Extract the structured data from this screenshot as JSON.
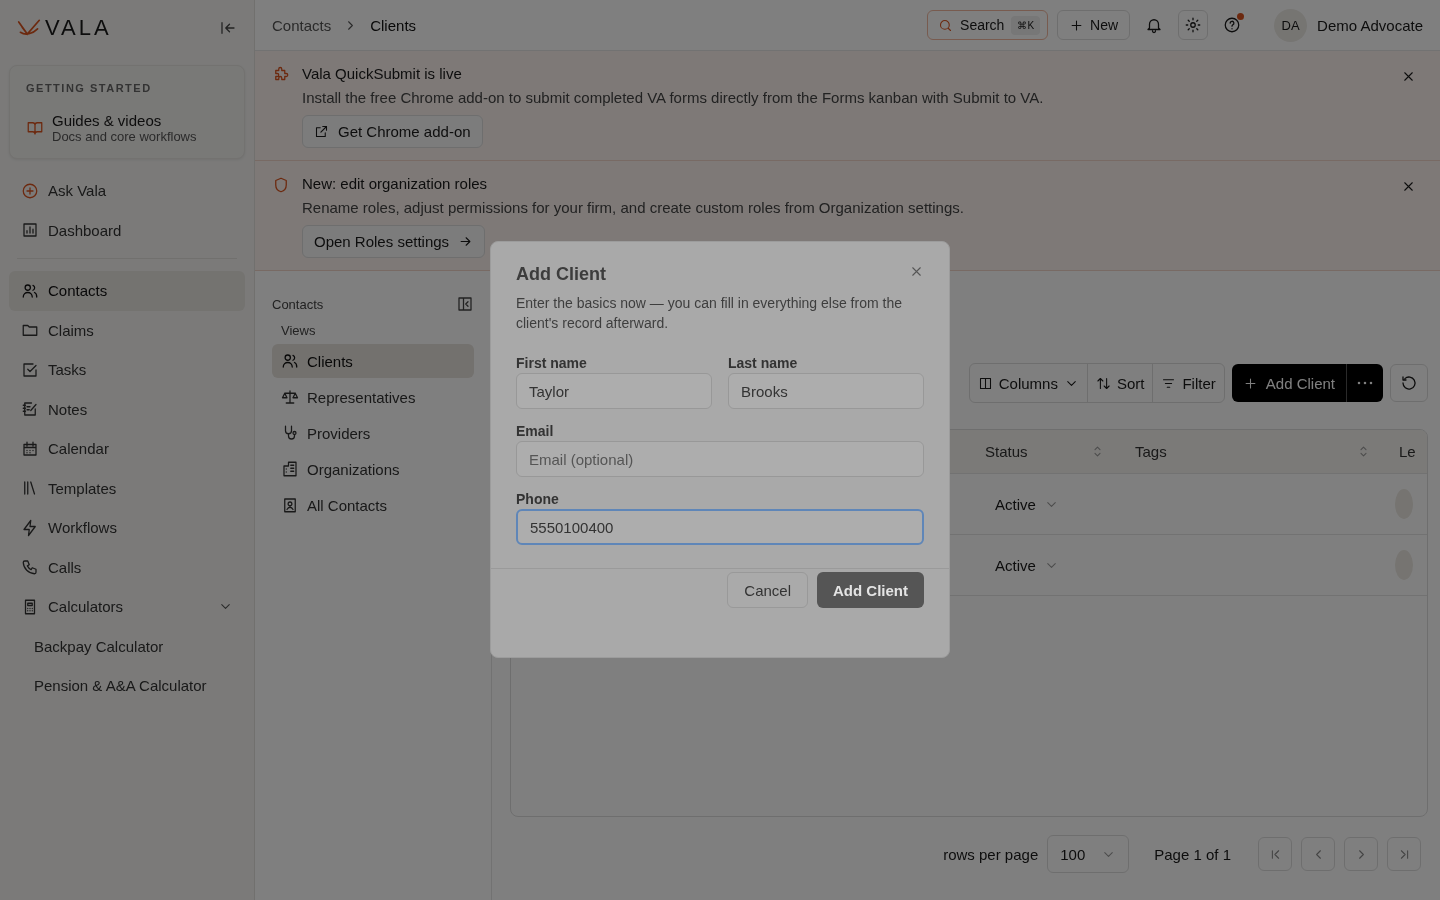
{
  "sidebar": {
    "logo": "VALA",
    "getting_started": {
      "heading": "GETTING STARTED",
      "title": "Guides & videos",
      "subtitle": "Docs and core workflows"
    },
    "top_items": [
      {
        "label": "Ask Vala",
        "selected": false
      },
      {
        "label": "Dashboard",
        "selected": false
      }
    ],
    "items": [
      {
        "label": "Contacts",
        "selected": true
      },
      {
        "label": "Claims",
        "selected": false
      },
      {
        "label": "Tasks",
        "selected": false
      },
      {
        "label": "Notes",
        "selected": false
      },
      {
        "label": "Calendar",
        "selected": false
      },
      {
        "label": "Templates",
        "selected": false
      },
      {
        "label": "Workflows",
        "selected": false
      },
      {
        "label": "Calls",
        "selected": false
      },
      {
        "label": "Calculators",
        "selected": false,
        "expanded": true,
        "children": [
          {
            "label": "Backpay Calculator"
          },
          {
            "label": "Pension & A&A Calculator"
          }
        ]
      }
    ]
  },
  "topbar": {
    "breadcrumb": [
      "Contacts",
      "Clients"
    ],
    "search": {
      "label": "Search",
      "shortcut": "⌘K"
    },
    "new_button": "New",
    "help_notification": true,
    "user": {
      "initials": "DA",
      "name": "Demo Advocate"
    }
  },
  "banners": [
    {
      "title": "Vala QuickSubmit is live",
      "text": "Install the free Chrome add-on to submit completed VA forms directly from the Forms kanban with Submit to VA.",
      "button": "Get Chrome add-on"
    },
    {
      "title": "New: edit organization roles",
      "text": "Rename roles, adjust permissions for your firm, and create custom roles from Organization settings.",
      "button": "Open Roles settings"
    }
  ],
  "subnav": {
    "heading": "Contacts",
    "section": "Views",
    "items": [
      {
        "label": "Clients",
        "selected": true
      },
      {
        "label": "Representatives",
        "selected": false
      },
      {
        "label": "Providers",
        "selected": false
      },
      {
        "label": "Organizations",
        "selected": false
      },
      {
        "label": "All Contacts",
        "selected": false
      }
    ]
  },
  "content": {
    "toolbar": [
      "Columns",
      "Sort",
      "Filter"
    ],
    "add_button": "Add Client",
    "table": {
      "columns": [
        "Status",
        "Tags",
        "Le"
      ],
      "rows": [
        {
          "status": "Active"
        },
        {
          "status": "Active"
        }
      ]
    },
    "pagination": {
      "rows_label": "rows per page",
      "page_size": "100",
      "page_text": "Page 1 of 1"
    }
  },
  "modal": {
    "title": "Add Client",
    "description": "Enter the basics now — you can fill in everything else from the client's record afterward.",
    "fields": [
      {
        "label": "First name",
        "value": "Taylor",
        "focused": false
      },
      {
        "label": "Last name",
        "value": "Brooks",
        "focused": false
      },
      {
        "label": "Email",
        "placeholder": "Email (optional)",
        "focused": false
      },
      {
        "label": "Phone",
        "value": "5550100400",
        "focused": true
      }
    ],
    "cancel": "Cancel",
    "submit": "Add Client"
  }
}
